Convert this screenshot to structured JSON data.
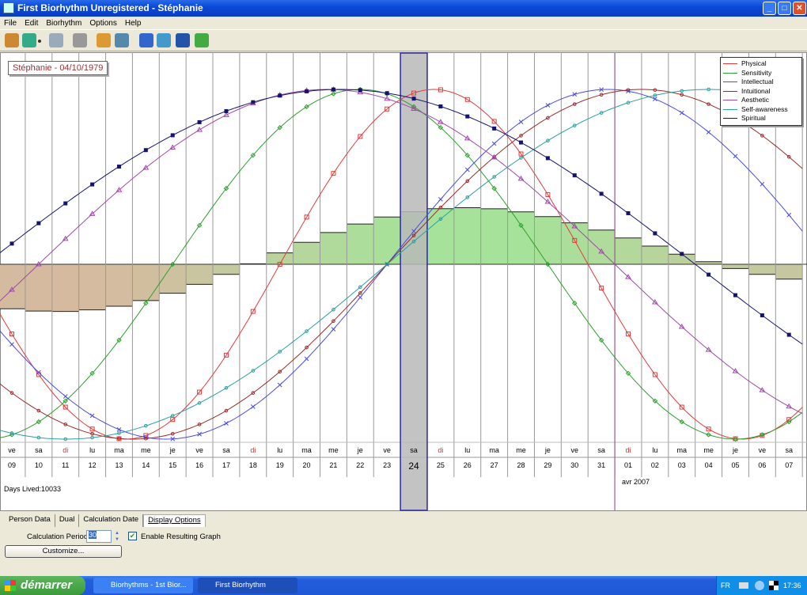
{
  "window": {
    "title": "First Biorhythm Unregistered - Stéphanie",
    "minimize": "_",
    "maximize": "□",
    "close": "✕"
  },
  "menu": [
    "File",
    "Edit",
    "Biorhythm",
    "Options",
    "Help"
  ],
  "toolbar": [
    {
      "name": "wizard-icon",
      "color": "#c83"
    },
    {
      "name": "save-icon",
      "color": "#3a8"
    },
    {
      "name": "dropdown-arrow-icon",
      "color": "#333"
    },
    {
      "name": "copy-icon",
      "color": "#9ab"
    },
    {
      "name": "print-icon",
      "color": "#999"
    },
    {
      "name": "persons-icon",
      "color": "#d93"
    },
    {
      "name": "chart-icon",
      "color": "#58a"
    },
    {
      "name": "help-icon",
      "color": "#36c"
    },
    {
      "name": "internet-icon",
      "color": "#49c"
    },
    {
      "name": "info-icon",
      "color": "#25a"
    },
    {
      "name": "register-icon",
      "color": "#4a4"
    }
  ],
  "person_label": "Stéphanie - 04/10/1979",
  "days_lived": "Days Lived:10033",
  "month_label": "avr 2007",
  "chart_data": {
    "type": "line",
    "days_lived_selected": 10033,
    "selected_day": "24",
    "day_names": [
      "ve",
      "sa",
      "di",
      "lu",
      "ma",
      "me",
      "je",
      "ve",
      "sa",
      "di",
      "lu",
      "ma",
      "me",
      "je",
      "ve",
      "sa",
      "di",
      "lu",
      "ma",
      "me",
      "je",
      "ve",
      "sa",
      "di",
      "lu",
      "ma",
      "me",
      "je",
      "ve",
      "sa"
    ],
    "dates": [
      "09",
      "10",
      "11",
      "12",
      "13",
      "14",
      "15",
      "16",
      "17",
      "18",
      "19",
      "20",
      "21",
      "22",
      "23",
      "24",
      "25",
      "26",
      "27",
      "28",
      "29",
      "30",
      "31",
      "01",
      "02",
      "03",
      "04",
      "05",
      "06",
      "07"
    ],
    "sunday_color": "#e03030",
    "ylim": [
      -1,
      1
    ],
    "legend_position": "top-right",
    "series": [
      {
        "name": "Physical",
        "period_days": 23,
        "color": "#e83a3a",
        "marker": "square-open"
      },
      {
        "name": "Sensitivity",
        "period_days": 28,
        "color": "#2e9e2e",
        "marker": "diamond"
      },
      {
        "name": "Intellectual",
        "period_days": 33,
        "color": "#4a4ae8",
        "marker": "x"
      },
      {
        "name": "Intuitional",
        "period_days": 38,
        "color": "#9a2a2a",
        "marker": "dot"
      },
      {
        "name": "Aesthetic",
        "period_days": 43,
        "color": "#a04aa8",
        "marker": "triangle"
      },
      {
        "name": "Self-awareness",
        "period_days": 48,
        "color": "#2aa0a0",
        "marker": "dot"
      },
      {
        "name": "Spiritual",
        "period_days": 53,
        "color": "#14146e",
        "marker": "square-filled"
      }
    ],
    "resulting_graph": {
      "enabled": true,
      "positive_color": "#a6e29a",
      "negative_color": "#d8b8a0"
    }
  },
  "tabs": [
    "Person Data",
    "Dual",
    "Calculation Date",
    "Display Options"
  ],
  "active_tab": "Display Options",
  "options": {
    "calc_period_label": "Calculation Period",
    "calc_period_value": "30",
    "enable_resulting_label": "Enable Resulting Graph",
    "enable_resulting_checked": true,
    "customize_label": "Customize..."
  },
  "taskbar": {
    "start": "démarrer",
    "tasks": [
      "Biorhythms - 1st Bior...",
      "First Biorhythm"
    ],
    "lang": "FR",
    "time": "17:36"
  }
}
